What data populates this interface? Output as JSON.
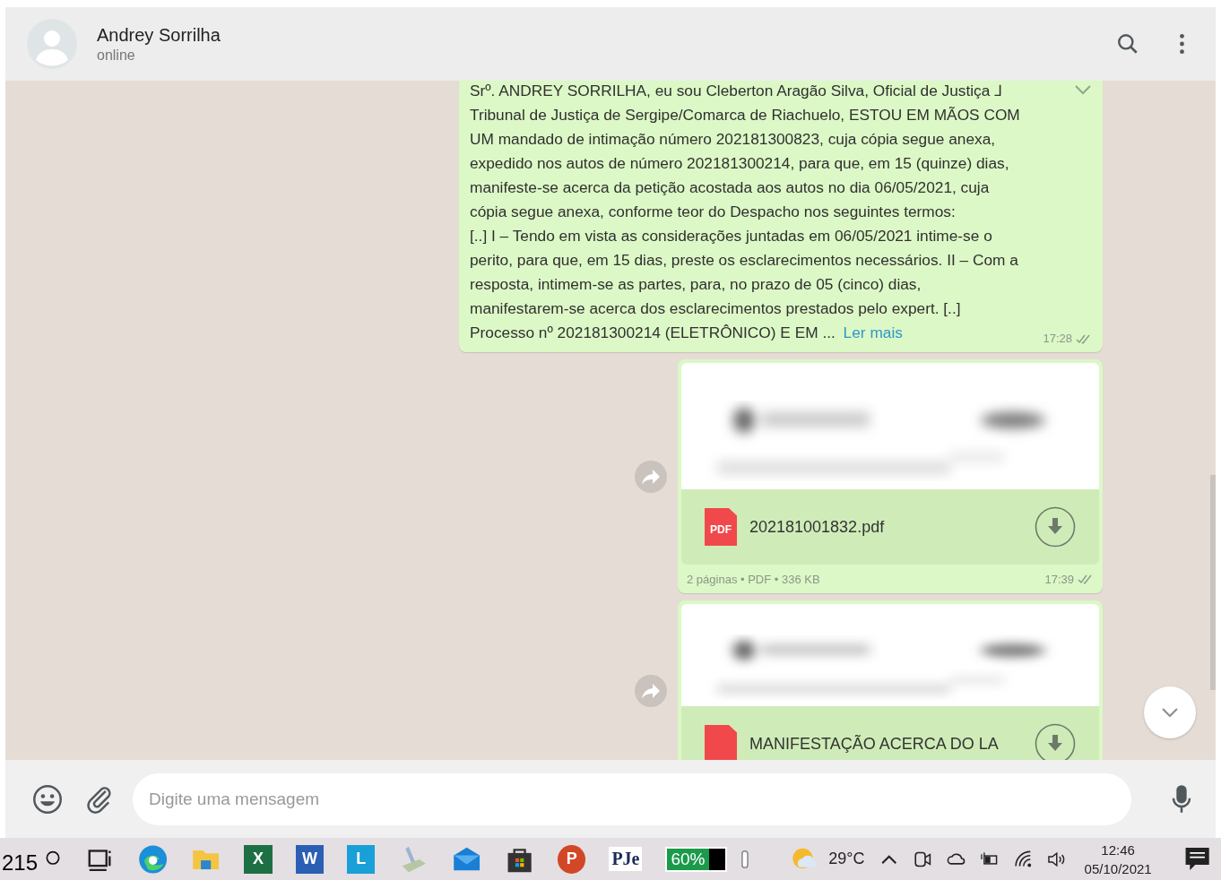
{
  "chat_header": {
    "name": "Andrey Sorrilha",
    "status": "online"
  },
  "messages": [
    {
      "kind": "text",
      "text": "Srº. ANDREY SORRILHA, eu sou Cleberton Aragão Silva, Oficial de Justiça ⅃\nTribunal de Justiça de Sergipe/Comarca de Riachuelo, ESTOU EM MÃOS COM\nUM mandado de intimação número 202181300823, cuja cópia segue anexa,\nexpedido nos autos de número 202181300214, para que, em 15 (quinze) dias,\nmanifeste-se acerca da petição acostada aos autos no dia 06/05/2021, cuja\ncópia segue anexa, conforme teor do Despacho nos seguintes termos:\n[..] I – Tendo em vista as considerações juntadas em 06/05/2021 intime-se o\nperito, para que, em 15 dias, preste os esclarecimentos necessários. II – Com a\nresposta, intimem-se as partes, para, no prazo de 05 (cinco) dias,\nmanifestarem-se acerca dos esclarecimentos prestados pelo expert. [..]\nProcesso nº 202181300214 (ELETRÔNICO) E EM ...",
      "link": "Ler mais",
      "time": "17:28"
    },
    {
      "kind": "document",
      "file_name": "202181001832.pdf",
      "file_icon": "PDF",
      "meta": "2 páginas • PDF • 336 KB",
      "time": "17:39"
    },
    {
      "kind": "document",
      "file_name": "MANIFESTAÇÃO ACERCA DO LA"
    }
  ],
  "composer": {
    "placeholder": "Digite uma mensagem"
  },
  "taskbar": {
    "overlay_text": "215",
    "apps": [
      {
        "kind": "taskview"
      },
      {
        "kind": "edge"
      },
      {
        "kind": "folder"
      },
      {
        "kind": "tile",
        "label": "X",
        "color": "#1d7044"
      },
      {
        "kind": "tile",
        "label": "W",
        "color": "#2b5fb4"
      },
      {
        "kind": "tile",
        "label": "L",
        "color": "#1aa0d8"
      },
      {
        "kind": "scanner"
      },
      {
        "kind": "mail"
      },
      {
        "kind": "store"
      },
      {
        "kind": "round",
        "label": "P",
        "color": "#d24726"
      },
      {
        "kind": "pje",
        "label": "PJe"
      }
    ],
    "battery": "60%",
    "temperature": "29°C",
    "clock_time": "12:46",
    "clock_date": "05/10/2021"
  }
}
